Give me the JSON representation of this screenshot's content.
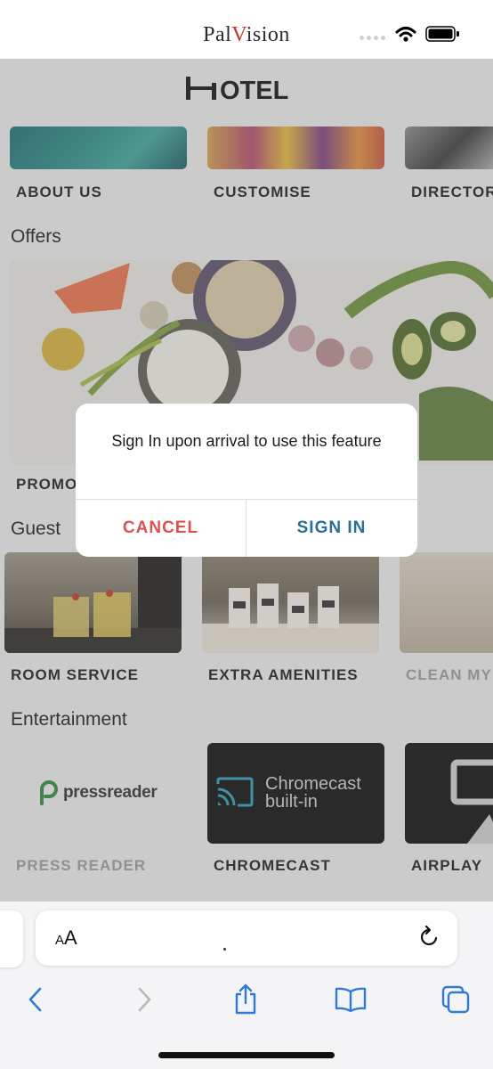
{
  "status_bar": {
    "carrier_pre": "Pal",
    "carrier_accent": "V",
    "carrier_post": "ision",
    "icons": [
      "cellular-signal-icon",
      "wifi-icon",
      "battery-icon"
    ]
  },
  "header": {
    "logo_text": "HOTEL"
  },
  "top_row": [
    {
      "label": "ABOUT US"
    },
    {
      "label": "CUSTOMISE"
    },
    {
      "label": "DIRECTOR"
    }
  ],
  "offers": {
    "title": "Offers",
    "tile_label": "PROMO"
  },
  "guest": {
    "title": "Guest",
    "items": [
      {
        "label": "ROOM SERVICE"
      },
      {
        "label": "EXTRA AMENITIES"
      },
      {
        "label": "CLEAN MY"
      }
    ]
  },
  "entertainment": {
    "title": "Entertainment",
    "items": [
      {
        "label": "PRESS READER",
        "logo_text": "pressreader"
      },
      {
        "label": "CHROMECAST",
        "logo_line1": "Chromecast",
        "logo_line2": "built-in"
      },
      {
        "label": "AIRPLAY"
      }
    ]
  },
  "alert": {
    "message": "Sign In upon arrival to use this feature",
    "cancel_label": "CANCEL",
    "signin_label": "SIGN IN",
    "colors": {
      "cancel": "#d9534f",
      "signin": "#2a6f97"
    }
  },
  "browser": {
    "aa_big": "A",
    "aa_small": "A",
    "icons": [
      "text-size-icon",
      "reload-icon",
      "back-icon",
      "forward-icon",
      "share-icon",
      "bookmarks-icon",
      "tabs-icon"
    ]
  }
}
